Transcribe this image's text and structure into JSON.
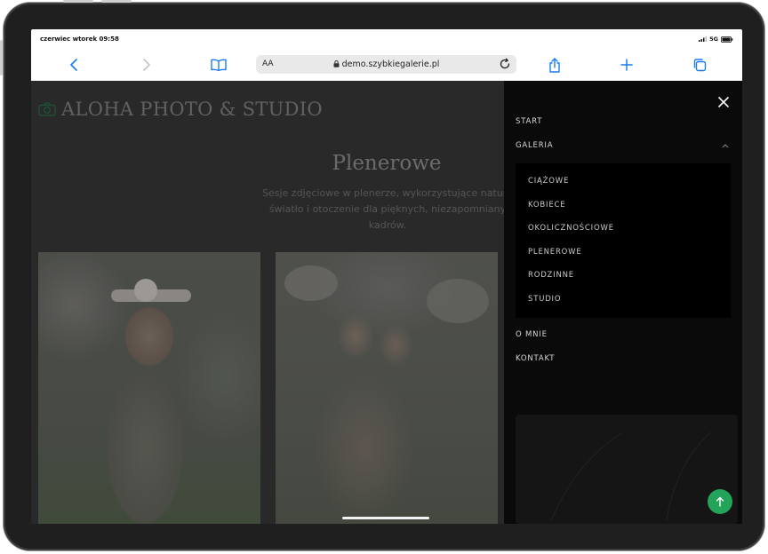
{
  "status_bar": {
    "time": "czerwiec wtorek 09:58",
    "network": "5G"
  },
  "browser": {
    "text_size_label": "AA",
    "url": "demo.szybkiegalerie.pl",
    "icons": [
      "back-icon",
      "forward-icon",
      "bookmarks-icon",
      "lock-icon",
      "reload-icon",
      "share-icon",
      "new-tab-icon",
      "tabs-icon"
    ]
  },
  "site": {
    "logo_text": "ALOHA PHOTO & STUDIO",
    "page_title": "Plenerowe",
    "description_lines": [
      "Sesje zdjęciowe w plenerze, wykorzystujące natura",
      "światło i otoczenie dla pięknych, niezapomniany",
      "kadrów."
    ]
  },
  "menu": {
    "items": [
      {
        "label": "START"
      },
      {
        "label": "GALERIA"
      },
      {
        "label": "O MNIE"
      },
      {
        "label": "KONTAKT"
      }
    ],
    "gallery_submenu": [
      {
        "label": "CIĄŻOWE"
      },
      {
        "label": "KOBIECE"
      },
      {
        "label": "OKOLICZNOŚCIOWE"
      },
      {
        "label": "PLENEROWE"
      },
      {
        "label": "RODZINNE"
      },
      {
        "label": "STUDIO"
      }
    ]
  },
  "colors": {
    "accent_green": "#23a45a",
    "menu_bg": "#0a0a0a",
    "page_bg": "#292929"
  }
}
